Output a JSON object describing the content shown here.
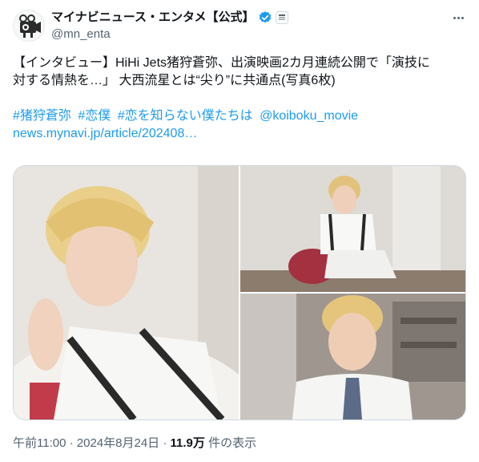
{
  "author": {
    "display_name": "マイナビニュース・エンタメ【公式】",
    "handle": "@mn_enta"
  },
  "tweet": {
    "line1": "【インタビュー】HiHi Jets猪狩蒼弥、出演映画2カ月連続公開で「演技に",
    "line2": "対する情熱を…」 大西流星とは“尖り”に共通点(写真6枚)",
    "hashtags": [
      "#猪狩蒼弥",
      "#恋僕",
      "#恋を知らない僕たちは"
    ],
    "mention": "@koiboku_movie",
    "link": "news.mynavi.jp/article/202408…"
  },
  "meta": {
    "time": "午前11:00",
    "sep": "·",
    "date": "2024年8月24日",
    "views_value": "11.9万",
    "views_label": "件の表示"
  },
  "colors": {
    "link": "#1d9bf0",
    "verified": "#1d9bf0",
    "text": "#0f1419",
    "secondary": "#536471"
  },
  "icons": {
    "avatar": "camera-mascot-avatar",
    "verified": "verified-badge-icon",
    "affiliation": "affiliation-badge-icon",
    "more": "more-options-icon"
  }
}
